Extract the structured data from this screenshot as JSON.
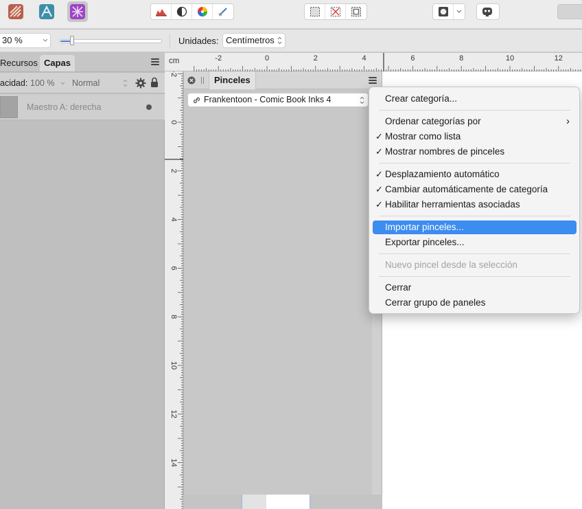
{
  "toolbar": {
    "personas": [
      {
        "name": "designer-persona",
        "color": "#b5614e"
      },
      {
        "name": "publisher-persona",
        "color": "#3f8ea8"
      },
      {
        "name": "photo-persona",
        "color": "#9b45c4"
      }
    ]
  },
  "context_bar": {
    "zoom_value": "30 %",
    "units_label": "Unidades:",
    "units_value": "Centímetros"
  },
  "left_panel": {
    "tabs": [
      "Recursos",
      "Capas"
    ],
    "active_tab": "Capas",
    "opacity_label": "acidad:",
    "opacity_value": "100 %",
    "blend_mode": "Normal",
    "layer_name": "Maestro A: derecha"
  },
  "ruler": {
    "unit": "cm",
    "top_labels": [
      "-2",
      "0",
      "2",
      "4",
      "6",
      "8",
      "10",
      "12"
    ],
    "left_labels": [
      "-2",
      "0",
      "2",
      "4",
      "6",
      "8",
      "10",
      "12",
      "14"
    ]
  },
  "brushes_panel": {
    "title": "Pinceles",
    "category": "Frankentoon - Comic Book Inks 4"
  },
  "menu": {
    "items": [
      {
        "label": "Crear categoría...",
        "checked": false,
        "submenu": false,
        "disabled": false,
        "highlighted": false
      },
      {
        "label": "Ordenar categorías por",
        "checked": false,
        "submenu": true,
        "disabled": false,
        "highlighted": false
      },
      {
        "label": "Mostrar como lista",
        "checked": true,
        "submenu": false,
        "disabled": false,
        "highlighted": false
      },
      {
        "label": "Mostrar nombres de pinceles",
        "checked": true,
        "submenu": false,
        "disabled": false,
        "highlighted": false
      },
      {
        "label": "Desplazamiento automático",
        "checked": true,
        "submenu": false,
        "disabled": false,
        "highlighted": false
      },
      {
        "label": "Cambiar automáticamente de categoría",
        "checked": true,
        "submenu": false,
        "disabled": false,
        "highlighted": false
      },
      {
        "label": "Habilitar herramientas asociadas",
        "checked": true,
        "submenu": false,
        "disabled": false,
        "highlighted": false
      },
      {
        "label": "Importar pinceles...",
        "checked": false,
        "submenu": false,
        "disabled": false,
        "highlighted": true
      },
      {
        "label": "Exportar pinceles...",
        "checked": false,
        "submenu": false,
        "disabled": false,
        "highlighted": false
      },
      {
        "label": "Nuevo pincel desde la selección",
        "checked": false,
        "submenu": false,
        "disabled": true,
        "highlighted": false
      },
      {
        "label": "Cerrar",
        "checked": false,
        "submenu": false,
        "disabled": false,
        "highlighted": false
      },
      {
        "label": "Cerrar grupo de paneles",
        "checked": false,
        "submenu": false,
        "disabled": false,
        "highlighted": false
      }
    ]
  }
}
